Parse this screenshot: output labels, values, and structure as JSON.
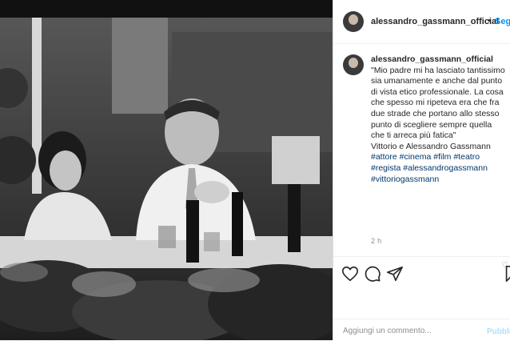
{
  "post": {
    "username": "alessandro_gassmann_official",
    "follow_label": "Segui",
    "separator": "•",
    "caption_text": "\"Mio padre mi ha lasciato tantissimo sia umanamente e anche dal punto di vista etico professionale. La cosa che spesso mi ripeteva era che fra due strade che portano allo stesso punto di scegliere sempre quella che ti arreca più fatica\"",
    "caption_people": "Vittorio e Alessandro Gassmann",
    "hashtags_line1": [
      "#attore",
      "#cinema",
      "#film",
      "#teatro"
    ],
    "hashtags_line2": [
      "#regista",
      "#alessandrogassmann"
    ],
    "hashtags_line3": [
      "#vittoriogassmann"
    ],
    "time": "2 h"
  },
  "comment": {
    "placeholder": "Aggiungi un commento...",
    "publish_label": "Pubblica"
  },
  "colors": {
    "link": "#00376b",
    "follow": "#0095f6",
    "publish_disabled": "#b2dffc",
    "muted": "#8e8e8e"
  },
  "icons": {
    "like": "heart-icon",
    "comment": "comment-icon",
    "share": "share-icon",
    "save": "bookmark-icon"
  }
}
